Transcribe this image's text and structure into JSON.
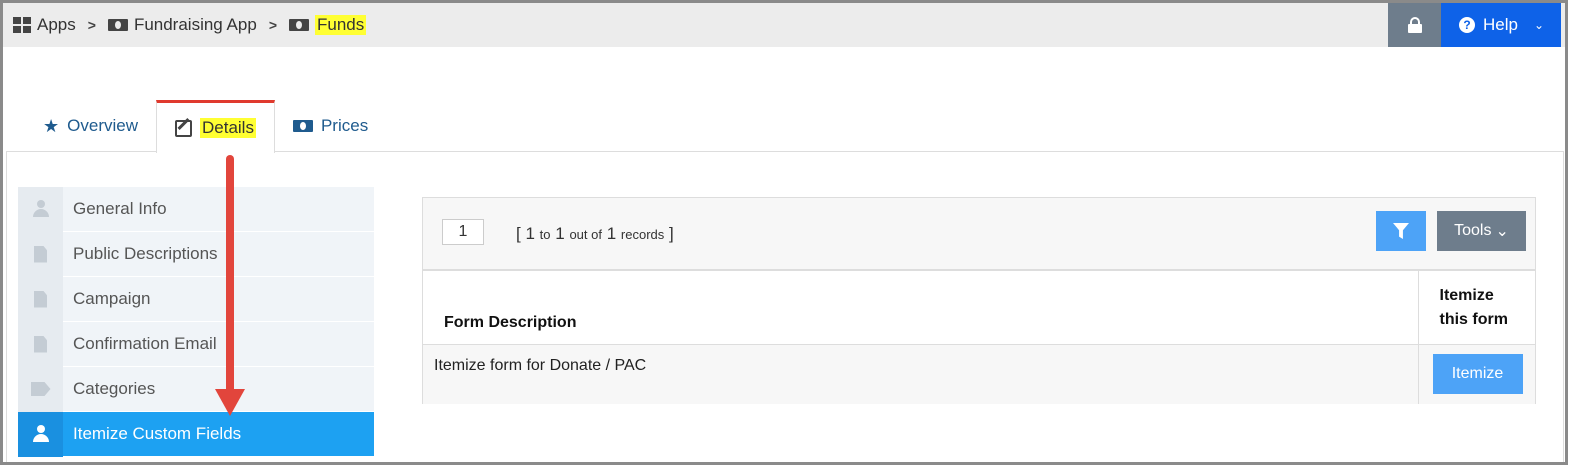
{
  "breadcrumb": {
    "items": [
      {
        "label": "Apps",
        "icon": "grid-icon"
      },
      {
        "label": "Fundraising App",
        "icon": "money-icon"
      },
      {
        "label": "Funds",
        "icon": "money-icon",
        "highlighted": true
      }
    ],
    "separator": ">"
  },
  "header": {
    "lock_icon": "lock-icon",
    "help_label": "Help",
    "help_chevron": "⌄"
  },
  "tabs": [
    {
      "label": "Overview",
      "icon": "star-icon"
    },
    {
      "label": "Details",
      "icon": "edit-icon",
      "active": true,
      "highlighted": true
    },
    {
      "label": "Prices",
      "icon": "money-icon"
    }
  ],
  "sidebar": {
    "items": [
      {
        "label": "General Info",
        "icon": "user-icon"
      },
      {
        "label": "Public Descriptions",
        "icon": "document-icon"
      },
      {
        "label": "Campaign",
        "icon": "document-icon"
      },
      {
        "label": "Confirmation Email",
        "icon": "document-icon"
      },
      {
        "label": "Categories",
        "icon": "tags-icon"
      },
      {
        "label": "Itemize Custom Fields",
        "icon": "user-icon",
        "active": true
      }
    ]
  },
  "pager": {
    "page": "1",
    "open_bracket": "[",
    "from": "1",
    "to_word": "to",
    "to": "1",
    "out_of_word": "out of",
    "total": "1",
    "records_word": "records",
    "close_bracket": "]"
  },
  "toolbar": {
    "filter_icon": "filter-icon",
    "tools_label": "Tools",
    "tools_chevron": "⌄"
  },
  "table": {
    "columns": [
      "Form Description",
      "Itemize this form"
    ],
    "rows": [
      {
        "description": "Itemize form for Donate / PAC",
        "action_label": "Itemize"
      }
    ]
  },
  "colors": {
    "help_button": "#0e62e8",
    "active_sidebar": "#1da1f2",
    "action_button": "#4da3f7",
    "active_tab_border": "#e03a2e",
    "annotation_arrow": "#e2453c",
    "highlight": "#ffff33"
  }
}
